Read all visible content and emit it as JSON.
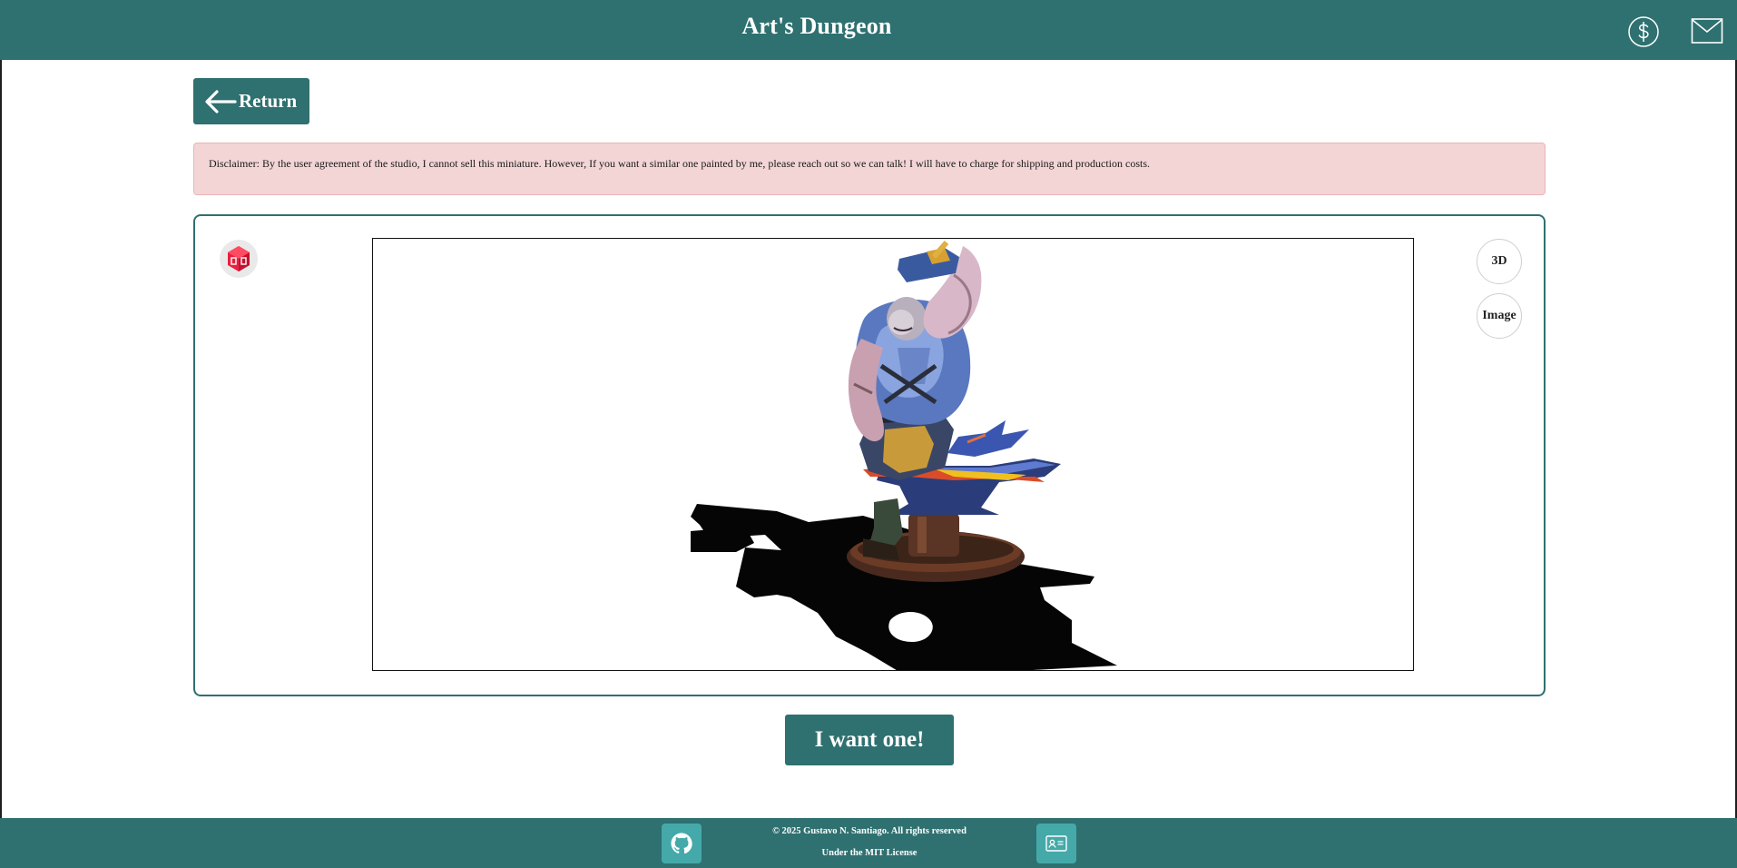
{
  "header": {
    "title": "Art's Dungeon",
    "icons": [
      "dollar-icon",
      "mail-icon"
    ]
  },
  "nav": {
    "return_label": "Return"
  },
  "disclaimer": {
    "text": "Disclaimer: By the user agreement of the studio, I cannot sell this miniature. However, If you want a similar one painted by me, please reach out so we can talk! I will have to charge for shipping and production costs."
  },
  "viewer": {
    "ar_icon": "ar-cube-icon",
    "modes": [
      "3D",
      "Image"
    ],
    "model_subject": "painted miniature of a blacksmith at an anvil"
  },
  "cta": {
    "label": "I want one!"
  },
  "footer": {
    "copyright": "© 2025 Gustavo N. Santiago. All rights reserved",
    "license": "Under the MIT License",
    "icons": [
      "github-icon",
      "contact-card-icon"
    ]
  },
  "colors": {
    "brand": "#2f7070",
    "footer_button": "#45a9a9",
    "disclaimer_bg": "#f3d5d6",
    "ar_red": "#e8203f"
  }
}
